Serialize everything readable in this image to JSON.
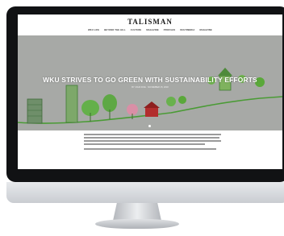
{
  "site": {
    "name": "TALISMAN"
  },
  "nav": {
    "items": [
      "WKU LIFE",
      "BEYOND THE HILL",
      "CULTURE",
      "MAGAZINE",
      "PROFILES",
      "MULTIMEDIA",
      "MAGAZINE"
    ]
  },
  "hero": {
    "title": "WKU STRIVES TO GO GREEN WITH SUSTAINABILITY EFFORTS",
    "meta": "BY JOHN DOE · NOVEMBER 15, 2018",
    "colors": {
      "background": "#a7a9a6",
      "drawing": "#5aa83a"
    }
  },
  "article": {
    "text_color": "#9a9a9a"
  }
}
